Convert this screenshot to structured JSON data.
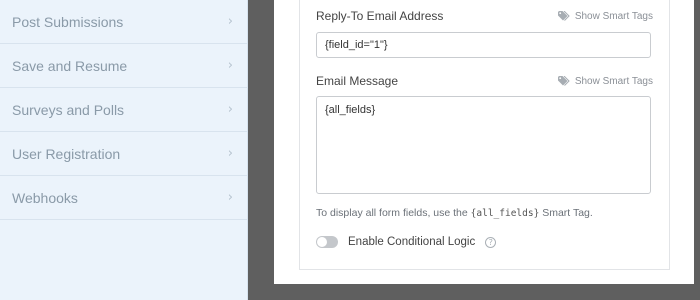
{
  "sidebar": {
    "items": [
      {
        "label": "Post Submissions"
      },
      {
        "label": "Save and Resume"
      },
      {
        "label": "Surveys and Polls"
      },
      {
        "label": "User Registration"
      },
      {
        "label": "Webhooks"
      }
    ],
    "chevron": "›"
  },
  "form": {
    "reply_to": {
      "label": "Reply-To Email Address",
      "smart_tags": "Show Smart Tags",
      "value": "{field_id=\"1\"}"
    },
    "message": {
      "label": "Email Message",
      "smart_tags": "Show Smart Tags",
      "value": "{all_fields}"
    },
    "help": {
      "before": "To display all form fields, use the ",
      "code": "{all_fields}",
      "after": " Smart Tag."
    },
    "conditional": {
      "label": "Enable Conditional Logic",
      "enabled": false,
      "help_glyph": "?"
    }
  },
  "icons": {
    "tag": "tag-icon",
    "chevron": "chevron-right-icon",
    "help": "help-circle-icon"
  },
  "colors": {
    "sidebar_bg": "#ebf3fb",
    "backdrop": "#5f5f5f"
  }
}
